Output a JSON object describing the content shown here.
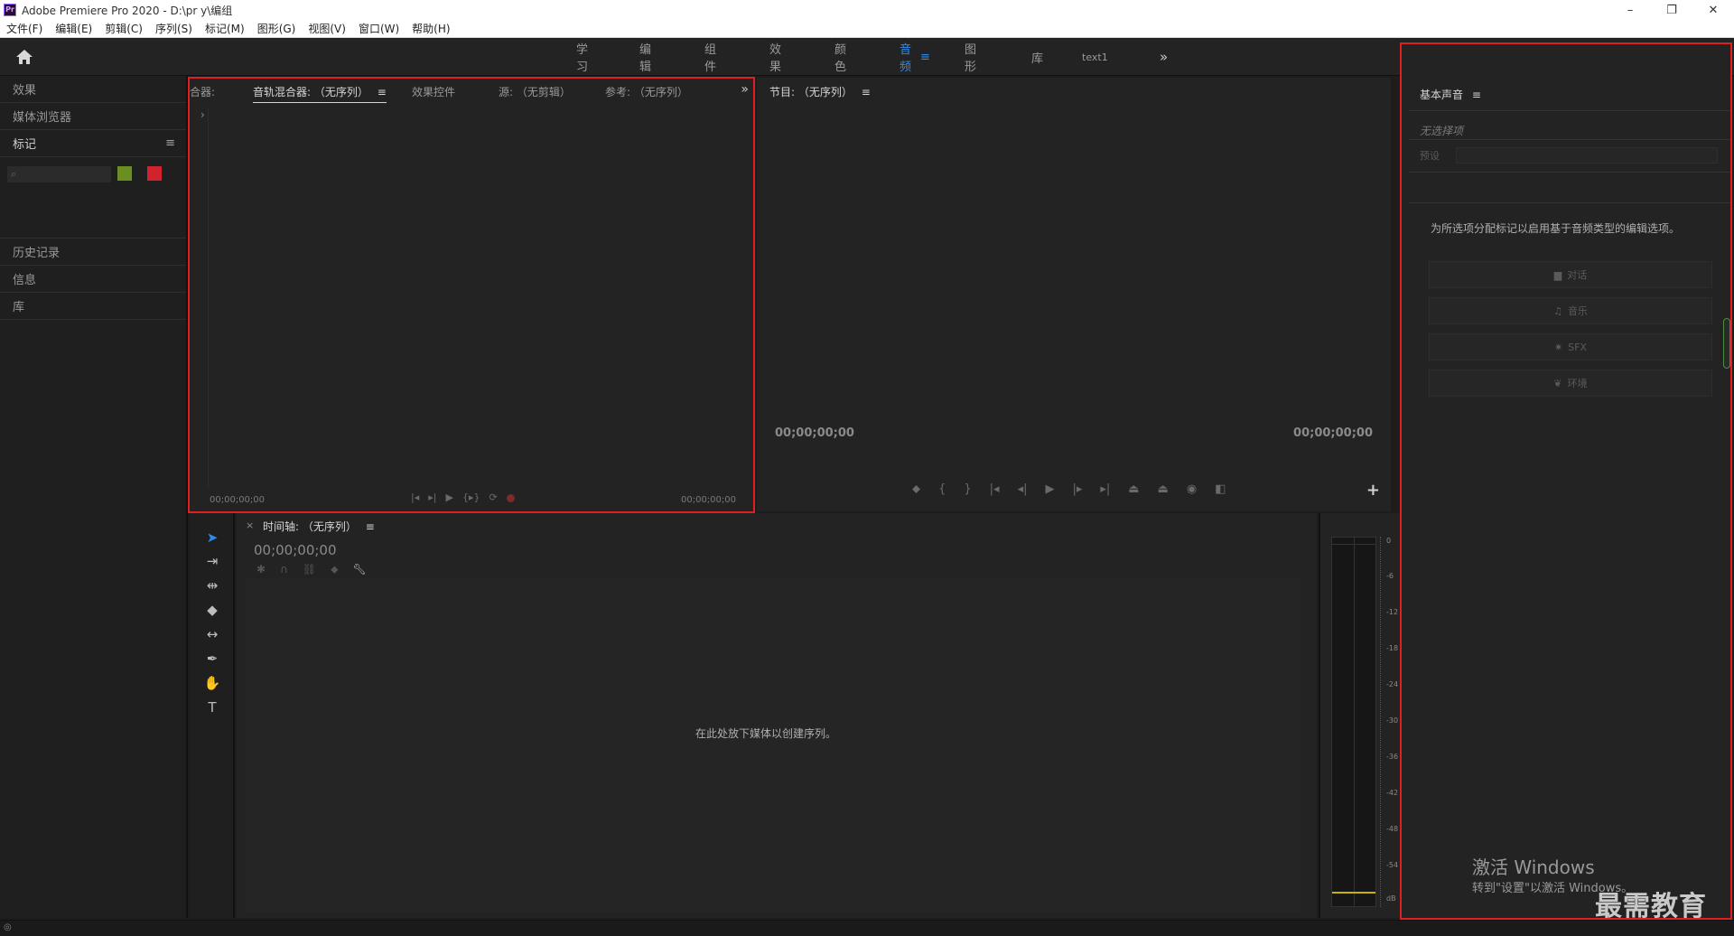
{
  "window": {
    "title": "Adobe Premiere Pro 2020 - D:\\pr y\\编组",
    "logo": "Pr",
    "minimize": "–",
    "restore": "❐",
    "close": "✕"
  },
  "menu": [
    "文件(F)",
    "编辑(E)",
    "剪辑(C)",
    "序列(S)",
    "标记(M)",
    "图形(G)",
    "视图(V)",
    "窗口(W)",
    "帮助(H)"
  ],
  "workspaces": {
    "tabs": [
      "学习",
      "编辑",
      "组件",
      "效果",
      "颜色",
      "音频",
      "图形",
      "库",
      "text1"
    ],
    "active": "音频",
    "menu_glyph": "≡",
    "overflow": "»"
  },
  "left_panel": {
    "effects": "效果",
    "media_browser": "媒体浏览器",
    "markers": "标记",
    "markers_menu": "≡",
    "history": "历史记录",
    "info": "信息",
    "libraries": "库",
    "marker_colors": [
      "#6b8e23",
      "#d0232e"
    ]
  },
  "mixer_panel": {
    "cut_tab": "合器:",
    "active_tab": "音轨混合器: （无序列）",
    "active_menu": "≡",
    "effect_controls": "效果控件",
    "source": "源: （无剪辑）",
    "reference": "参考: （无序列）",
    "overflow": "»",
    "chevron": "›",
    "tc_left": "00;00;00;00",
    "tc_right": "00;00;00;00"
  },
  "program_panel": {
    "title": "节目: （无序列）",
    "menu": "≡",
    "tc_left": "00;00;00;00",
    "tc_right": "00;00;00;00",
    "add": "+"
  },
  "essential_sound": {
    "title": "基本声音",
    "menu": "≡",
    "no_selection": "无选择项",
    "preset_label": "预设",
    "hint": "为所选项分配标记以启用基于音频类型的编辑选项。",
    "types": [
      "对话",
      "音乐",
      "SFX",
      "环境"
    ]
  },
  "timeline": {
    "close": "×",
    "title": "时间轴: （无序列）",
    "menu": "≡",
    "timecode": "00;00;00;00",
    "drop_hint": "在此处放下媒体以创建序列。"
  },
  "meter": {
    "scale": [
      "0",
      "-6",
      "-12",
      "-18",
      "-24",
      "-30",
      "-36",
      "-42",
      "-48",
      "-54",
      "dB"
    ]
  },
  "watermark": {
    "activate": "激活 Windows",
    "activate_sub": "转到\"设置\"以激活 Windows。",
    "brand": "最需教育"
  },
  "colors": {
    "accent": "#2d8ceb",
    "highlight_outline": "#e02020"
  }
}
